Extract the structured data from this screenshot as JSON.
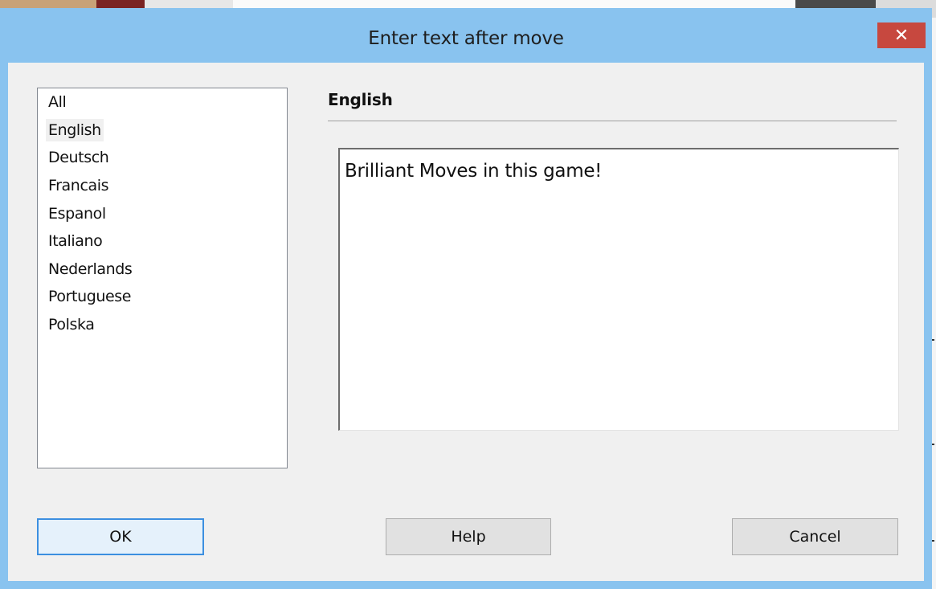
{
  "dialog": {
    "title": "Enter text after move",
    "close_label": "✕"
  },
  "languages": [
    {
      "label": "All"
    },
    {
      "label": "English",
      "selected": true
    },
    {
      "label": "Deutsch"
    },
    {
      "label": "Francais"
    },
    {
      "label": "Espanol"
    },
    {
      "label": "Italiano"
    },
    {
      "label": "Nederlands"
    },
    {
      "label": "Portuguese"
    },
    {
      "label": "Polska"
    }
  ],
  "section": {
    "title": "English"
  },
  "editor": {
    "value": "Brilliant Moves in this game!"
  },
  "buttons": {
    "ok": "OK",
    "help": "Help",
    "cancel": "Cancel"
  },
  "colors": {
    "titlebar": "#89c3ef",
    "close": "#c7483f",
    "client": "#f0f0f0",
    "default_button_border": "#3c8fe0"
  }
}
